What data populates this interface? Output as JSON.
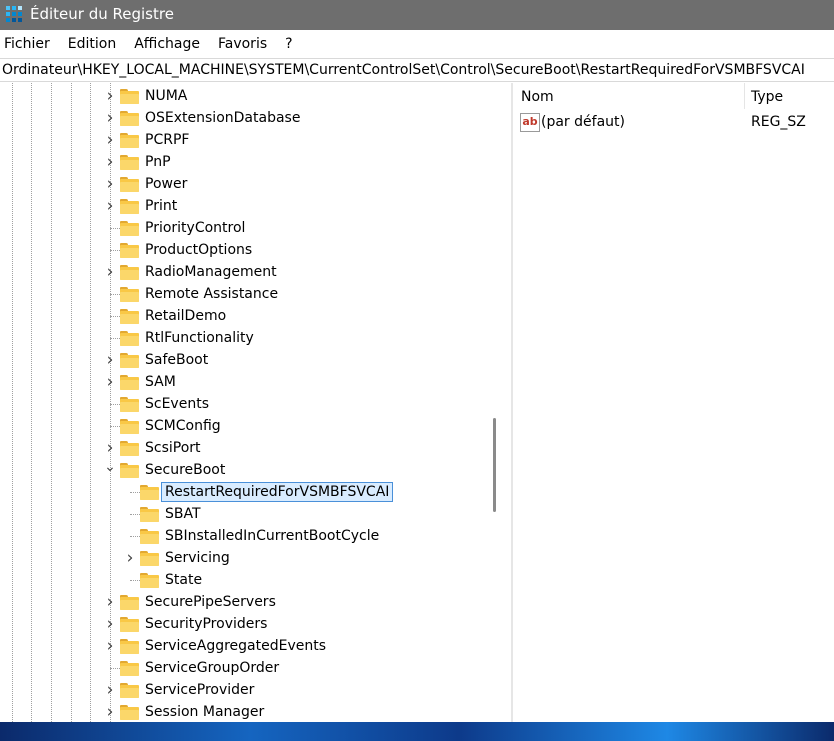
{
  "window": {
    "title": "Éditeur du Registre"
  },
  "menu": [
    "Fichier",
    "Edition",
    "Affichage",
    "Favoris",
    "?"
  ],
  "address": "Ordinateur\\HKEY_LOCAL_MACHINE\\SYSTEM\\CurrentControlSet\\Control\\SecureBoot\\RestartRequiredForVSMBFSVCAI",
  "tree": [
    {
      "label": "NUMA",
      "level": 1,
      "expandable": true
    },
    {
      "label": "OSExtensionDatabase",
      "level": 1,
      "expandable": true
    },
    {
      "label": "PCRPF",
      "level": 1,
      "expandable": true
    },
    {
      "label": "PnP",
      "level": 1,
      "expandable": true
    },
    {
      "label": "Power",
      "level": 1,
      "expandable": true
    },
    {
      "label": "Print",
      "level": 1,
      "expandable": true
    },
    {
      "label": "PriorityControl",
      "level": 1,
      "expandable": false
    },
    {
      "label": "ProductOptions",
      "level": 1,
      "expandable": false
    },
    {
      "label": "RadioManagement",
      "level": 1,
      "expandable": true
    },
    {
      "label": "Remote Assistance",
      "level": 1,
      "expandable": false
    },
    {
      "label": "RetailDemo",
      "level": 1,
      "expandable": false
    },
    {
      "label": "RtlFunctionality",
      "level": 1,
      "expandable": false
    },
    {
      "label": "SafeBoot",
      "level": 1,
      "expandable": true
    },
    {
      "label": "SAM",
      "level": 1,
      "expandable": true
    },
    {
      "label": "ScEvents",
      "level": 1,
      "expandable": false
    },
    {
      "label": "SCMConfig",
      "level": 1,
      "expandable": false
    },
    {
      "label": "ScsiPort",
      "level": 1,
      "expandable": true
    },
    {
      "label": "SecureBoot",
      "level": 1,
      "expandable": true,
      "expanded": true
    },
    {
      "label": "RestartRequiredForVSMBFSVCAI",
      "level": 2,
      "expandable": false,
      "selected": true
    },
    {
      "label": "SBAT",
      "level": 2,
      "expandable": false
    },
    {
      "label": "SBInstalledInCurrentBootCycle",
      "level": 2,
      "expandable": false
    },
    {
      "label": "Servicing",
      "level": 2,
      "expandable": true
    },
    {
      "label": "State",
      "level": 2,
      "expandable": false
    },
    {
      "label": "SecurePipeServers",
      "level": 1,
      "expandable": true
    },
    {
      "label": "SecurityProviders",
      "level": 1,
      "expandable": true
    },
    {
      "label": "ServiceAggregatedEvents",
      "level": 1,
      "expandable": true
    },
    {
      "label": "ServiceGroupOrder",
      "level": 1,
      "expandable": false
    },
    {
      "label": "ServiceProvider",
      "level": 1,
      "expandable": true
    },
    {
      "label": "Session Manager",
      "level": 1,
      "expandable": true
    }
  ],
  "list": {
    "columns": [
      "Nom",
      "Type"
    ],
    "rows": [
      {
        "icon": "string-value-icon",
        "icon_text": "ab",
        "name": "(par défaut)",
        "type": "REG_SZ"
      }
    ]
  },
  "colors": {
    "titlebar": "#6e6e6e",
    "selection": "#d9ecff",
    "selection_border": "#4a90d9",
    "folder": "#f9c846"
  }
}
